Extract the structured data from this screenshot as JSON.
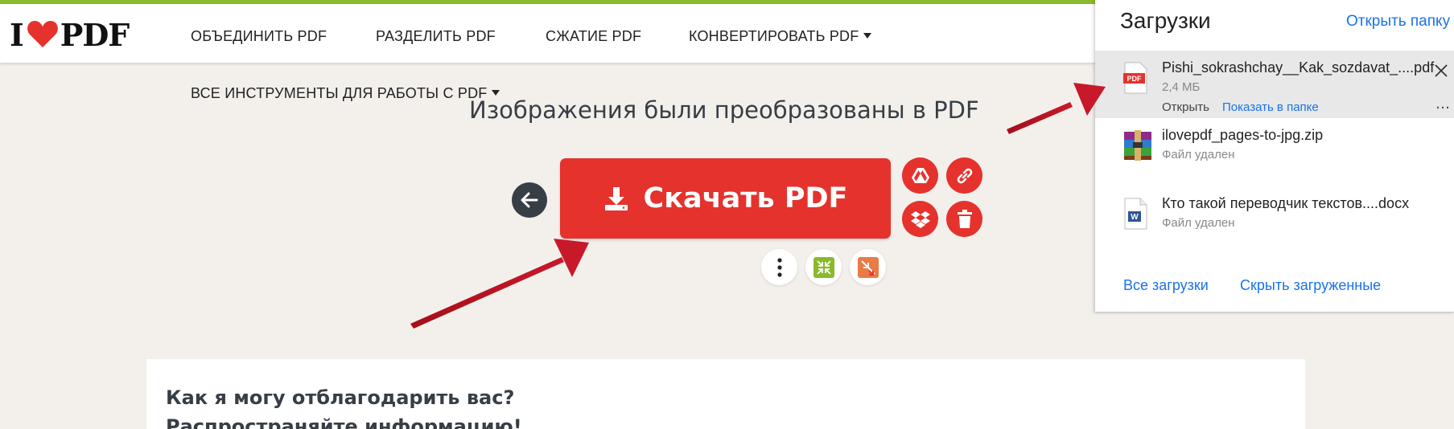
{
  "header": {
    "nav": [
      {
        "label": "ОБЪЕДИНИТЬ PDF"
      },
      {
        "label": "РАЗДЕЛИТЬ PDF"
      },
      {
        "label": "СЖАТИЕ PDF"
      },
      {
        "label": "КОНВЕРТИРОВАТЬ PDF"
      }
    ],
    "all_tools": "ВСЕ ИНСТРУМЕНТЫ ДЛЯ РАБОТЫ С PDF"
  },
  "main": {
    "title": "Изображения были преобразованы в PDF",
    "download_label": "Скачать PDF",
    "card_text": "Как я могу отблагодарить вас? Распространяйте информацию!"
  },
  "downloads": {
    "title": "Загрузки",
    "open_folder": "Открыть папку",
    "items": [
      {
        "name": "Pishi_sokrashchay__Kak_sozdavat_....pdf",
        "sub": "2,4 МБ",
        "open": "Открыть",
        "show_in_folder": "Показать в папке"
      },
      {
        "name": "ilovepdf_pages-to-jpg.zip",
        "sub": "Файл удален"
      },
      {
        "name": "Кто такой переводчик текстов....docx",
        "sub": "Файл удален"
      }
    ],
    "all_downloads": "Все загрузки",
    "hide_downloaded": "Скрыть загруженные"
  },
  "colors": {
    "brand_red": "#e5322d",
    "dark": "#383e45",
    "link_blue": "#1a73e8",
    "accent_green": "#8ab92d"
  }
}
